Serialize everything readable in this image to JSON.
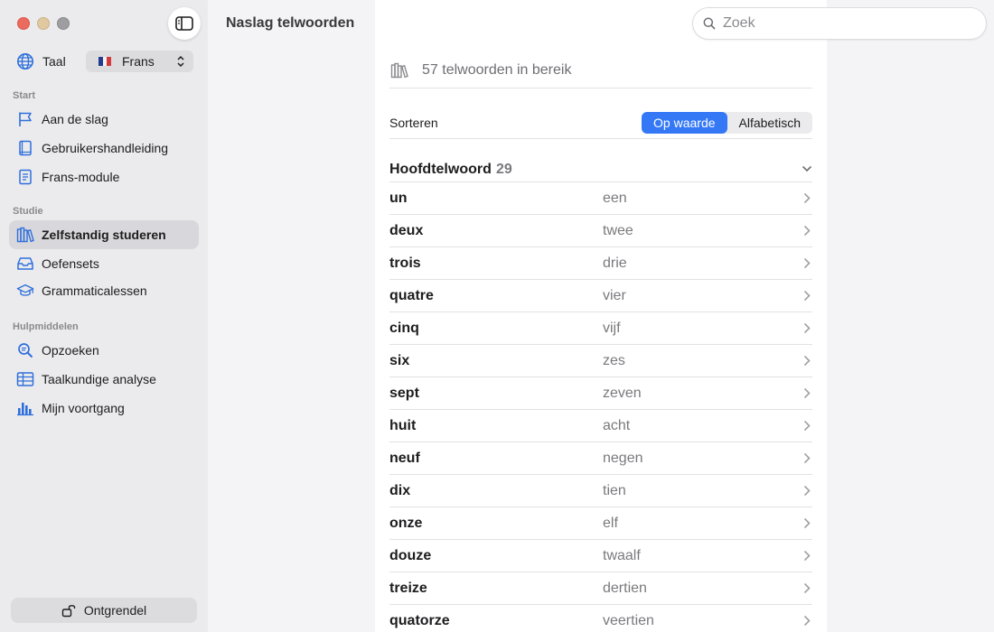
{
  "window": {
    "title": "Naslag telwoorden"
  },
  "sidebar": {
    "language_label": "Taal",
    "language_value": "Frans",
    "sections": [
      {
        "title": "Start",
        "items": [
          "Aan de slag",
          "Gebruikershandleiding",
          "Frans-module"
        ]
      },
      {
        "title": "Studie",
        "items": [
          "Zelfstandig studeren",
          "Oefensets",
          "Grammaticalessen"
        ]
      },
      {
        "title": "Hulpmiddelen",
        "items": [
          "Opzoeken",
          "Taalkundige analyse",
          "Mijn voortgang"
        ]
      }
    ],
    "selected_item": "Zelfstandig studeren",
    "unlock_label": "Ontgrendel"
  },
  "search": {
    "placeholder": "Zoek"
  },
  "main": {
    "range_text": "57 telwoorden in bereik",
    "sort_label": "Sorteren",
    "sort_options": [
      "Op waarde",
      "Alfabetisch"
    ],
    "sort_selected": "Op waarde",
    "group": {
      "title": "Hoofdtelwoord",
      "count": "29"
    },
    "rows": [
      {
        "fr": "un",
        "nl": "een"
      },
      {
        "fr": "deux",
        "nl": "twee"
      },
      {
        "fr": "trois",
        "nl": "drie"
      },
      {
        "fr": "quatre",
        "nl": "vier"
      },
      {
        "fr": "cinq",
        "nl": "vijf"
      },
      {
        "fr": "six",
        "nl": "zes"
      },
      {
        "fr": "sept",
        "nl": "zeven"
      },
      {
        "fr": "huit",
        "nl": "acht"
      },
      {
        "fr": "neuf",
        "nl": "negen"
      },
      {
        "fr": "dix",
        "nl": "tien"
      },
      {
        "fr": "onze",
        "nl": "elf"
      },
      {
        "fr": "douze",
        "nl": "twaalf"
      },
      {
        "fr": "treize",
        "nl": "dertien"
      },
      {
        "fr": "quatorze",
        "nl": "veertien"
      }
    ]
  },
  "colors": {
    "accent": "#3478f6",
    "icon": "#2f6fdb",
    "sidebar_bg": "#ebebed",
    "selected_bg": "#d8d8dc"
  },
  "icons": {
    "language": "globe-icon",
    "nav": [
      "flag-icon",
      "book-icon",
      "notebook-icon",
      "books-icon",
      "tray-icon",
      "graduation-cap-icon",
      "magnifier-icon",
      "table-icon",
      "bar-chart-icon"
    ],
    "range": "books-icon",
    "search": "search-icon",
    "row": "chevron-right-icon",
    "group": "chevron-down-icon",
    "unlock": "unlock-icon"
  }
}
